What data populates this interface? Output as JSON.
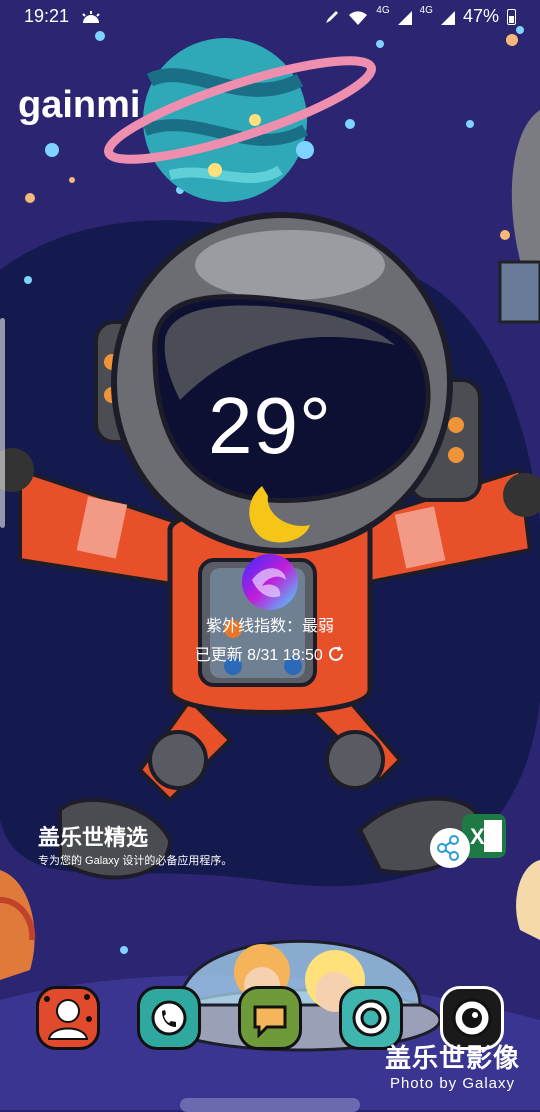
{
  "status_bar": {
    "time": "19:21",
    "signal_1": "4G",
    "signal_2": "4G",
    "battery_percent": "47%",
    "battery_level": 0.47
  },
  "home": {
    "title": "gainmi"
  },
  "weather": {
    "temperature": "29°",
    "uv_index": "紫外线指数：最弱",
    "updated": "已更新 8/31 18:50"
  },
  "galaxy_picks": {
    "title": "盖乐世精选",
    "description": "专为您的 Galaxy 设计的必备应用程序。"
  },
  "watermark": {
    "main": "盖乐世影像",
    "sub": "Photo by Galaxy"
  },
  "colors": {
    "background": "#2a2470",
    "suit_orange": "#e8502a",
    "helmet_gray": "#6b6d72",
    "moon_yellow": "#f5c518",
    "planet_teal": "#2fa8b8"
  },
  "icons": {
    "status": [
      "weather-icon",
      "pen-icon",
      "wifi-icon",
      "signal-icon",
      "battery-icon"
    ],
    "dock": [
      "contacts-icon",
      "phone-icon",
      "messages-icon",
      "browser-icon",
      "camera-icon"
    ],
    "refresh": "refresh-icon"
  }
}
